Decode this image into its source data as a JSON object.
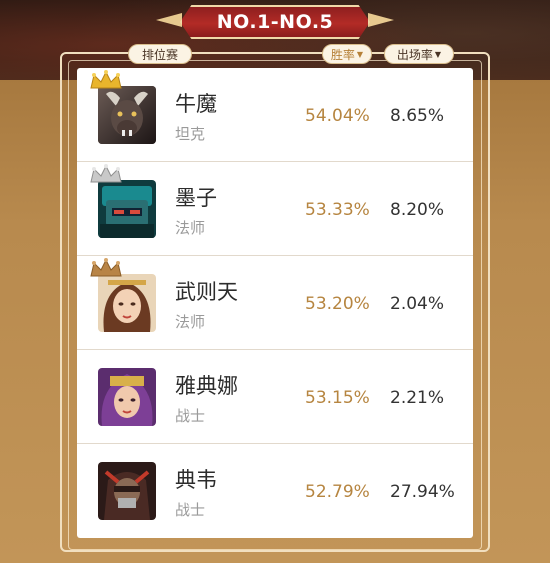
{
  "header": {
    "title": "NO.1-NO.5"
  },
  "tabs": {
    "rank_mode": "排位赛",
    "win_rate": "胜率",
    "pick_rate": "出场率",
    "sort_symbol": "▼"
  },
  "heroes": [
    {
      "rank": 1,
      "name": "牛魔",
      "role": "坦克",
      "win_rate": "54.04%",
      "pick_rate": "8.65%",
      "crown": "gold-crown-icon",
      "crown_color": "#e9b52c",
      "avatar_icon": "bull-demon-avatar"
    },
    {
      "rank": 2,
      "name": "墨子",
      "role": "法师",
      "win_rate": "53.33%",
      "pick_rate": "8.20%",
      "crown": "silver-crown-icon",
      "crown_color": "#c9c9c9",
      "avatar_icon": "mech-robot-avatar"
    },
    {
      "rank": 3,
      "name": "武则天",
      "role": "法师",
      "win_rate": "53.20%",
      "pick_rate": "2.04%",
      "crown": "bronze-crown-icon",
      "crown_color": "#b88446",
      "avatar_icon": "empress-avatar"
    },
    {
      "rank": 4,
      "name": "雅典娜",
      "role": "战士",
      "win_rate": "53.15%",
      "pick_rate": "2.21%",
      "crown": "",
      "crown_color": "",
      "avatar_icon": "athena-avatar"
    },
    {
      "rank": 5,
      "name": "典韦",
      "role": "战士",
      "win_rate": "52.79%",
      "pick_rate": "27.94%",
      "crown": "",
      "crown_color": "",
      "avatar_icon": "dianwei-avatar"
    }
  ],
  "colors": {
    "accent_gold": "#b68540",
    "ribbon_red": "#b32b26",
    "background_gold": "#b88a4e"
  }
}
